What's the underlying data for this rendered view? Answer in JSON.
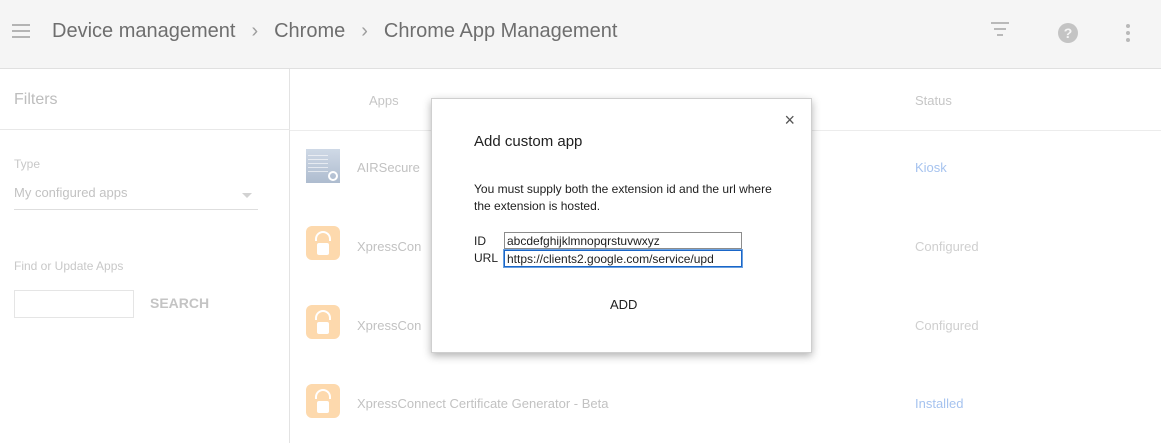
{
  "header": {
    "breadcrumbs": [
      "Device management",
      "Chrome",
      "Chrome App Management"
    ],
    "separator": "›",
    "icons": [
      "menu-icon",
      "filter-icon",
      "help-icon",
      "more-vert-icon"
    ],
    "help_glyph": "?"
  },
  "sidebar": {
    "title": "Filters",
    "type_label": "Type",
    "type_selected": "My configured apps",
    "find_label": "Find or Update Apps",
    "search_value": "",
    "search_button": "SEARCH"
  },
  "table": {
    "headers": {
      "apps": "Apps",
      "status": "Status"
    },
    "rows": [
      {
        "name": "AIRSecure",
        "status": "Kiosk",
        "status_color": "#a6c3ef",
        "icon": "air-secure-icon"
      },
      {
        "name": "XpressCon",
        "status": "Configured",
        "status_color": "#cfcfcf",
        "icon": "xpressconnect-icon"
      },
      {
        "name": "XpressCon",
        "status": "Configured",
        "status_color": "#cfcfcf",
        "icon": "xpressconnect-icon"
      },
      {
        "name": "XpressConnect Certificate Generator - Beta",
        "status": "Installed",
        "status_color": "#a6c3ef",
        "icon": "xpressconnect-icon"
      }
    ]
  },
  "dialog": {
    "title": "Add custom app",
    "close_glyph": "×",
    "message": "You must supply both the extension id and the url where the extension is hosted.",
    "id_label": "ID",
    "id_value": "abcdefghijklmnopqrstuvwxyz",
    "url_label": "URL",
    "url_value": "https://clients2.google.com/service/upd",
    "add_button": "ADD"
  },
  "colors": {
    "header_bg": "#f5f5f5",
    "link_blue": "#a6c3ef",
    "focus_blue": "#1a66c8",
    "xpress_orange": "#fdd9ad"
  }
}
